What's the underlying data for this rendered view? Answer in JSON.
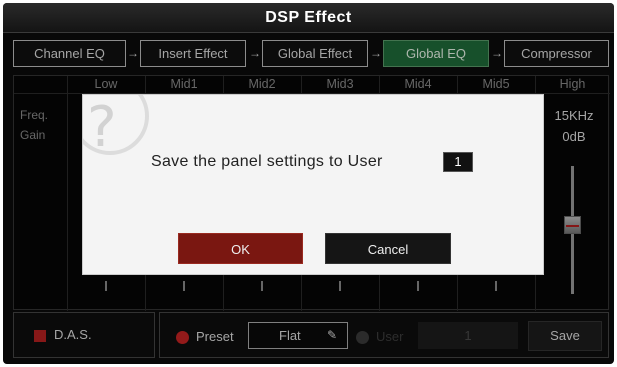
{
  "title": "DSP Effect",
  "tabs": [
    {
      "label": "Channel EQ"
    },
    {
      "label": "Insert Effect"
    },
    {
      "label": "Global Effect"
    },
    {
      "label": "Global EQ",
      "active": true
    },
    {
      "label": "Compressor"
    }
  ],
  "eq": {
    "bands": [
      "Low",
      "Mid1",
      "Mid2",
      "Mid3",
      "Mid4",
      "Mid5",
      "High"
    ],
    "freq_label": "Freq.",
    "gain_label": "Gain",
    "high_freq": "15KHz",
    "high_gain": "0dB"
  },
  "dialog": {
    "message": "Save the panel settings to User",
    "user_number": "1",
    "ok_label": "OK",
    "cancel_label": "Cancel"
  },
  "bottom": {
    "das_label": "D.A.S.",
    "preset_label": "Preset",
    "preset_value": "Flat",
    "user_label": "User",
    "user_value": "1",
    "save_label": "Save"
  },
  "colors": {
    "active_tab": "#1f6b3a",
    "ok_button": "#7a1711",
    "accent_red": "#c42323"
  }
}
